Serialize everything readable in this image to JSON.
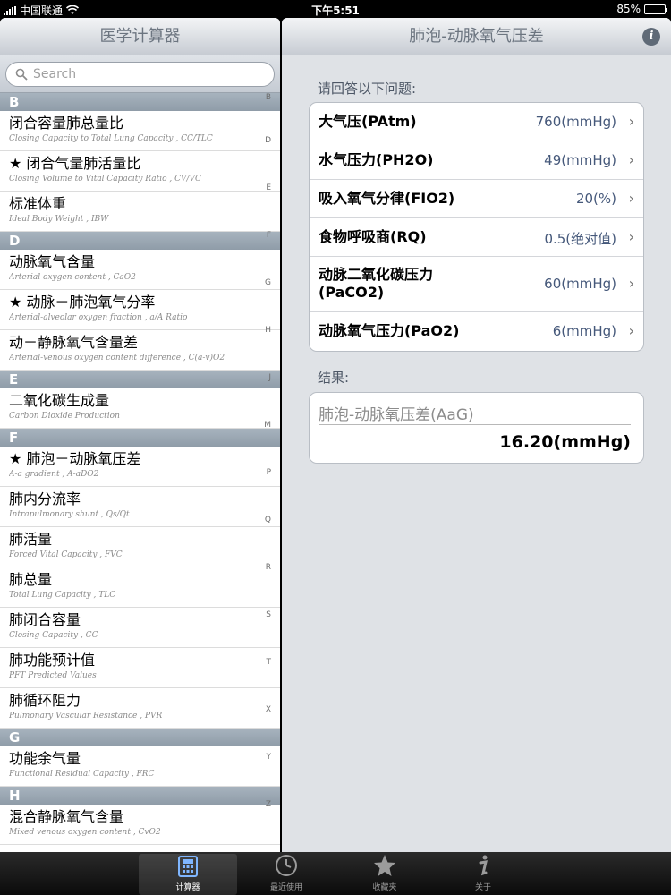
{
  "status": {
    "carrier": "中国联通",
    "time": "下午5:51",
    "battery": "85%",
    "battery_level": 0.85
  },
  "left": {
    "title": "医学计算器",
    "search_placeholder": "Search",
    "sections": [
      {
        "header": "B",
        "rows": [
          {
            "title": "闭合容量肺总量比",
            "subtitle": "Closing Capacity to Total Lung Capacity , CC/TLC"
          },
          {
            "title": "★ 闭合气量肺活量比",
            "subtitle": "Closing Volume to Vital Capacity Ratio , CV/VC"
          },
          {
            "title": "标准体重",
            "subtitle": "Ideal Body Weight , IBW"
          }
        ]
      },
      {
        "header": "D",
        "rows": [
          {
            "title": "动脉氧气含量",
            "subtitle": "Arterial oxygen content , CaO2"
          },
          {
            "title": "★ 动脉－肺泡氧气分率",
            "subtitle": "Arterial-alveolar oxygen fraction , a/A Ratio"
          },
          {
            "title": "动－静脉氧气含量差",
            "subtitle": "Arterial-venous oxygen content difference , C(a-v)O2"
          }
        ]
      },
      {
        "header": "E",
        "rows": [
          {
            "title": "二氧化碳生成量",
            "subtitle": "Carbon Dioxide Production"
          }
        ]
      },
      {
        "header": "F",
        "rows": [
          {
            "title": "★ 肺泡－动脉氧压差",
            "subtitle": "A-a gradient , A-aDO2"
          },
          {
            "title": "肺内分流率",
            "subtitle": "Intrapulmonary shunt , Qs/Qt"
          },
          {
            "title": "肺活量",
            "subtitle": "Forced Vital Capacity , FVC"
          },
          {
            "title": "肺总量",
            "subtitle": "Total Lung Capacity , TLC"
          },
          {
            "title": "肺闭合容量",
            "subtitle": "Closing Capacity , CC"
          },
          {
            "title": "肺功能预计值",
            "subtitle": "PFT Predicted Values"
          },
          {
            "title": "肺循环阻力",
            "subtitle": "Pulmonary Vascular Resistance ,  PVR"
          }
        ]
      },
      {
        "header": "G",
        "rows": [
          {
            "title": "功能余气量",
            "subtitle": "Functional Residual Capacity , FRC"
          }
        ]
      },
      {
        "header": "H",
        "rows": [
          {
            "title": "混合静脉氧气含量",
            "subtitle": "Mixed venous oxygen content , CvO2"
          }
        ]
      }
    ],
    "index": [
      "B",
      "D",
      "E",
      "F",
      "G",
      "H",
      "J",
      "M",
      "P",
      "Q",
      "R",
      "S",
      "T",
      "X",
      "Y",
      "Z"
    ]
  },
  "right": {
    "title": "肺泡-动脉氧气压差",
    "questions_label": "请回答以下问题:",
    "inputs": [
      {
        "label": "大气压(PAtm)",
        "value": "760(mmHg)"
      },
      {
        "label": "水气压力(PH2O)",
        "value": "49(mmHg)"
      },
      {
        "label": "吸入氧气分律(FIO2)",
        "value": "20(%)"
      },
      {
        "label": "食物呼吸商(RQ)",
        "value": "0.5(绝对值)"
      },
      {
        "label": "动脉二氧化碳压力\n(PaCO2)",
        "value": "60(mmHg)"
      },
      {
        "label": "动脉氧气压力(PaO2)",
        "value": "6(mmHg)"
      }
    ],
    "result_label": "结果:",
    "result_name": "肺泡-动脉氧压差(AaG)",
    "result_value": "16.20(mmHg)"
  },
  "tabs": [
    {
      "label": "计算器",
      "icon": "calculator-icon",
      "active": true
    },
    {
      "label": "最近使用",
      "icon": "clock-icon",
      "active": false
    },
    {
      "label": "收藏夹",
      "icon": "star-icon",
      "active": false
    },
    {
      "label": "关于",
      "icon": "info-icon",
      "active": false
    }
  ]
}
